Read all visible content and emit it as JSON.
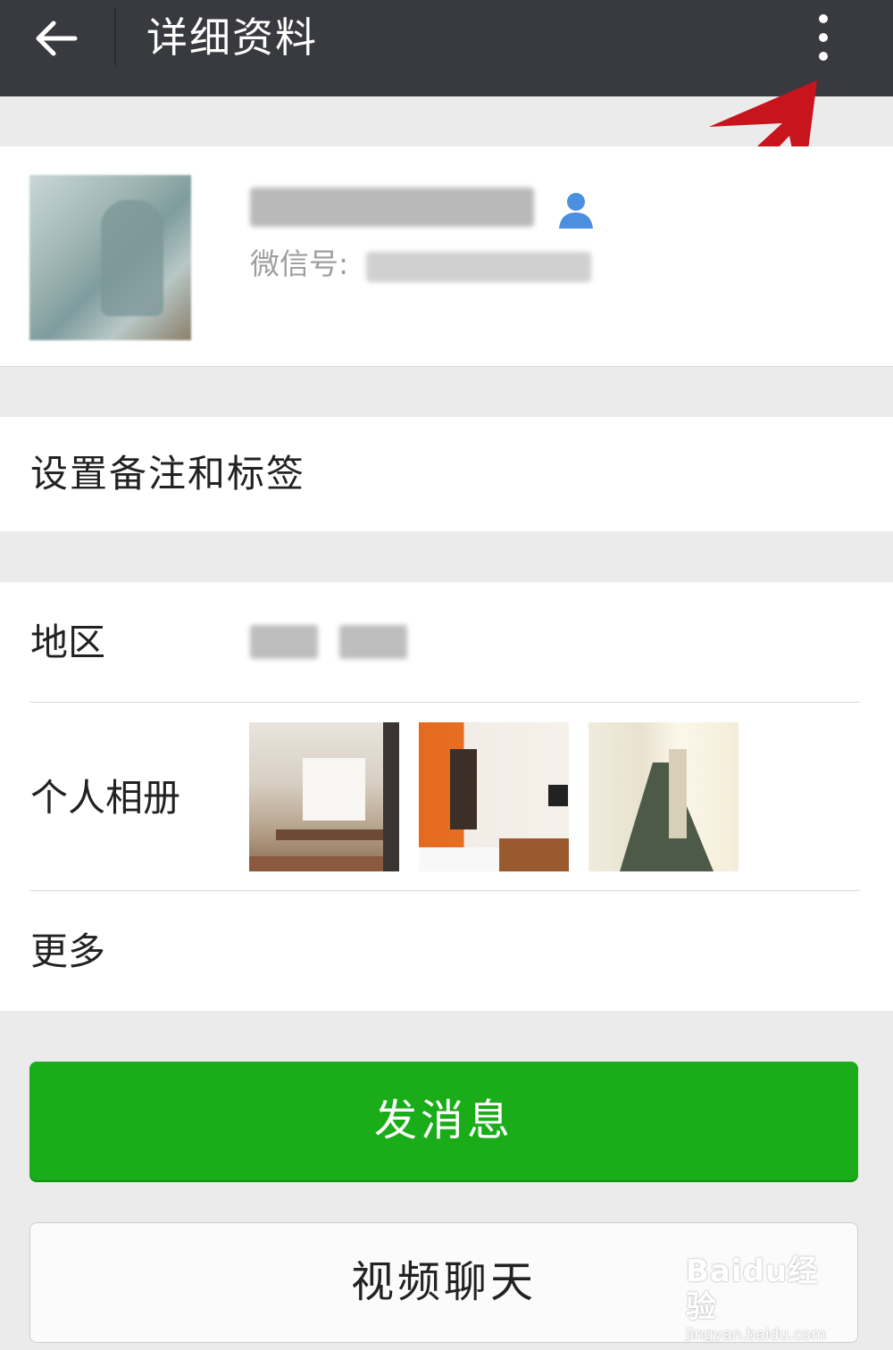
{
  "header": {
    "title": "详细资料"
  },
  "profile": {
    "wechat_id_label": "微信号:"
  },
  "menu": {
    "remark_tags_label": "设置备注和标签",
    "region_label": "地区",
    "album_label": "个人相册",
    "more_label": "更多"
  },
  "actions": {
    "send_message_label": "发消息",
    "video_chat_label": "视频聊天"
  },
  "watermark": {
    "brand": "Baidu经验",
    "url": "jingyan.baidu.com"
  },
  "colors": {
    "header_bg": "#393a3f",
    "primary_green": "#1aad19",
    "annotation_red": "#c8141c",
    "contact_icon_blue": "#4a8fe0"
  },
  "icons": [
    "back-arrow-icon",
    "more-vertical-icon",
    "contact-person-icon"
  ]
}
